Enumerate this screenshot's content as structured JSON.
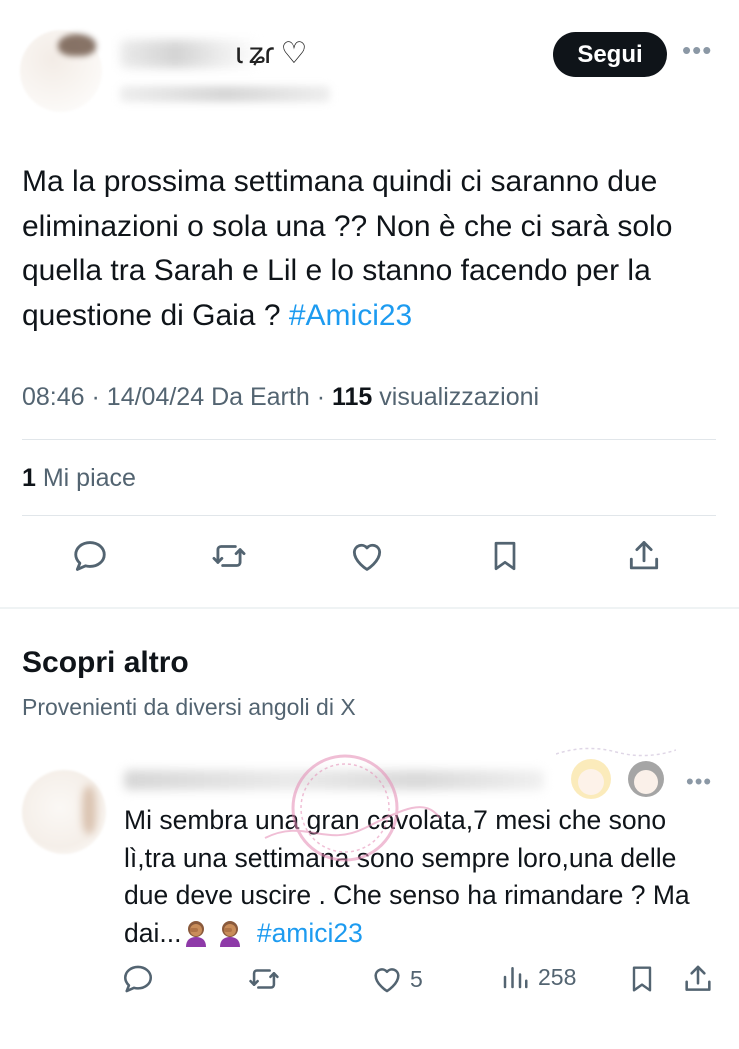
{
  "header": {
    "name_visible_suffix": "ɩ ʑɾ ♡",
    "follow_label": "Segui",
    "more_label": "•••"
  },
  "tweet": {
    "text_before_hashtag": "Ma la prossima settimana quindi ci saranno due eliminazioni o sola una ?? Non è che ci sarà solo quella tra Sarah e Lil e lo stanno facendo per la questione di Gaia ?",
    "hashtag": "#Amici23",
    "time": "08:46",
    "date": "14/04/24",
    "source": "Da Earth",
    "views_count": "115",
    "views_label": "visualizzazioni",
    "likes_count": "1",
    "likes_label": "Mi piace",
    "separator": "·"
  },
  "actions": [
    "reply-icon",
    "retweet-icon",
    "like-icon",
    "bookmark-icon",
    "share-icon"
  ],
  "discover": {
    "title": "Scopri altro",
    "subtitle": "Provenienti da diversi angoli di X"
  },
  "reply": {
    "text_main": "Mi sembra una gran cavolata,7 mesi che sono lì,tra una settimana sono sempre loro,una delle due deve uscire . Che senso ha rimandare ? Ma dai...",
    "emoji_count": 2,
    "hashtag": "#amici23",
    "likes": "5",
    "views": "258",
    "more_label": "•••"
  },
  "colors": {
    "accent": "#1d9bf0",
    "text": "#0f1419",
    "secondary": "#536471",
    "divider": "#e1e6ea",
    "button_bg": "#0f1419"
  }
}
